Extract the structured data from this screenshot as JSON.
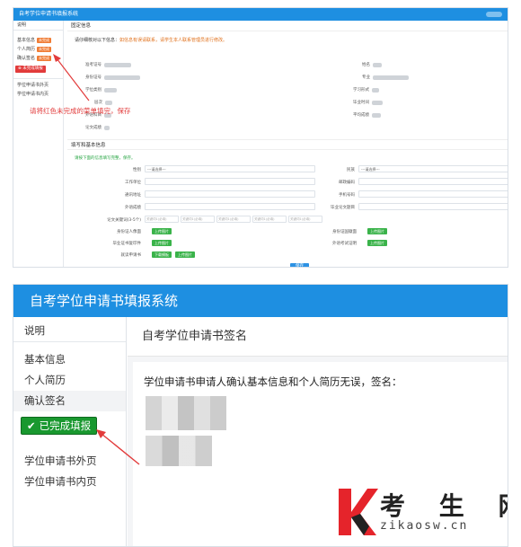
{
  "top_panel": {
    "header_title": "自考学位申请书填报系统",
    "sidebar": {
      "intro": "说明",
      "items": [
        {
          "label": "基本信息",
          "tag": "未完成"
        },
        {
          "label": "个人简历",
          "tag": "未完成"
        },
        {
          "label": "确认签名",
          "tag": "未完成"
        }
      ],
      "status_red": "未完成填报",
      "links": [
        "学位申请书外页",
        "学位申请书内页"
      ]
    },
    "section1_title": "固定信息",
    "warning_prefix": "请仔细核对以下信息：",
    "warning_text": "如信息有误请联系，请学生本人联系管理员进行修改。",
    "fields_left": [
      "准考证号",
      "身份证号",
      "学位类别",
      "层次",
      "外语科目",
      "论文成绩"
    ],
    "fields_right": [
      "姓名",
      "专业",
      "学习形式",
      "毕业时间",
      "平均成绩"
    ],
    "section2_title": "填写和基本信息",
    "section2_hint": "请按下面的信息填写完整，保存。",
    "form_left": [
      "性别",
      "工作单位",
      "通讯地址",
      "外语成绩"
    ],
    "form_right": [
      "民族",
      "邮政编码",
      "手机号码",
      "毕业论文题目"
    ],
    "select_placeholder": "---请选择---",
    "keyword_label": "论文关键词(3-5个)",
    "keyword_placeholder": "关键词1(必填)",
    "upload_rows_left": [
      "身份证人像面",
      "毕业证书复印件",
      "就读申请书"
    ],
    "upload_rows_right": [
      "身份证国徽面",
      "外语考试证明"
    ],
    "upload_btn": "上传图片",
    "download_btn": "下载模板",
    "save_btn": "保存",
    "annotation": "请将红色未完成的菜单填完，保存"
  },
  "bottom_panel": {
    "header_title": "自考学位申请书填报系统",
    "sidebar": {
      "intro": "说明",
      "items": [
        "基本信息",
        "个人简历",
        "确认签名"
      ],
      "done_label": "已完成填报",
      "links": [
        "学位申请书外页",
        "学位申请书内页"
      ]
    },
    "page_title": "自考学位申请书签名",
    "confirm_text": "学位申请书申请人确认基本信息和个人简历无误，签名："
  },
  "watermark": {
    "cn": "考 生 网",
    "url": "zikaosw.cn"
  },
  "colors": {
    "header_blue": "#1e8fe1",
    "done_green": "#19982f",
    "todo_orange": "#f07c35",
    "alert_red": "#e23b3b"
  }
}
